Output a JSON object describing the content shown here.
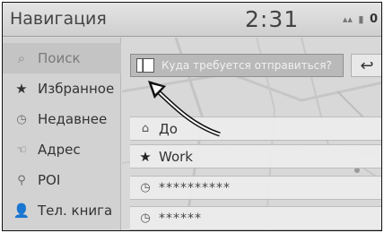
{
  "header": {
    "title": "Навигация",
    "clock": "2:31",
    "battery_level_label": "0"
  },
  "sidebar": {
    "items": [
      {
        "label": "Поиск",
        "icon": "search-icon",
        "selected": true
      },
      {
        "label": "Избранное",
        "icon": "star-icon"
      },
      {
        "label": "Недавнее",
        "icon": "clock-icon"
      },
      {
        "label": "Адрес",
        "icon": "address-icon"
      },
      {
        "label": "POI",
        "icon": "pin-icon"
      },
      {
        "label": "Тел. книга",
        "icon": "person-icon"
      }
    ]
  },
  "search": {
    "placeholder": "Куда требуется отправиться?"
  },
  "list": {
    "items": [
      {
        "label": "До",
        "icon": "home-icon"
      },
      {
        "label": "Work",
        "icon": "star-icon"
      },
      {
        "label": "**********",
        "icon": "clock-icon"
      },
      {
        "label": "******",
        "icon": "clock-icon"
      }
    ]
  },
  "colors": {
    "statusbar": "#d8d8d8",
    "sidebar": "#d2d2d2",
    "search_bar": "#b9b9b9",
    "text": "#333333"
  }
}
